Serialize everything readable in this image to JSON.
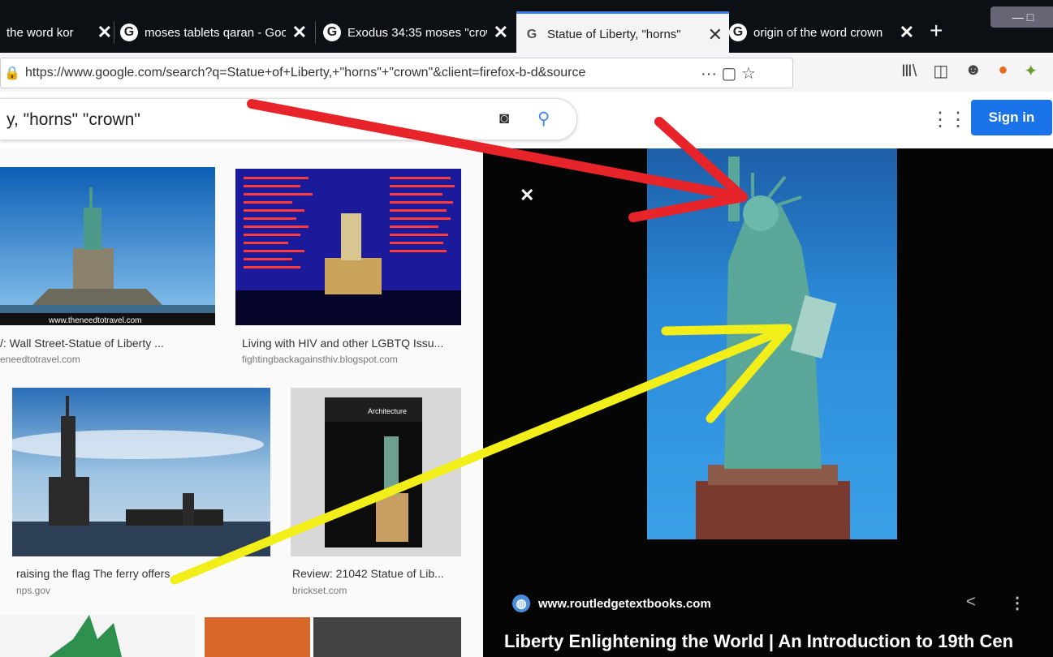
{
  "tabs": [
    {
      "title": "the word kor",
      "close": "✕"
    },
    {
      "title": "moses tablets qaran - Goo",
      "close": "✕"
    },
    {
      "title": "Exodus 34:35 moses \"crow",
      "close": "✕"
    },
    {
      "title": "Statue of Liberty, \"horns\"",
      "close": "✕"
    },
    {
      "title": "origin of the word crown",
      "close": "✕"
    }
  ],
  "browser": {
    "url": "https://www.google.com/search?q=Statue+of+Liberty,+\"horns\"+\"crown\"&client=firefox-b-d&source",
    "new_tab": "+",
    "page_actions": "··· ▢ ☆",
    "window_buttons": "— □"
  },
  "google": {
    "query": "y, \"horns\" \"crown\"",
    "signin": "Sign in"
  },
  "results": [
    {
      "caption": "/: Wall Street-Statue of Liberty ...",
      "site": "eneedtotravel.com",
      "watermark": "www.theneedtotravel.com"
    },
    {
      "caption": "Living with HIV and other LGBTQ Issu...",
      "site": "fightingbackagainsthiv.blogspot.com"
    },
    {
      "caption": "raising the flag The ferry offers",
      "site": "nps.gov"
    },
    {
      "caption": "Review: 21042 Statue of Lib...",
      "site": "brickset.com",
      "box_label": "Architecture"
    }
  ],
  "preview": {
    "source": "www.routledgetextbooks.com",
    "title": "Liberty Enlightening the World | An Introduction to 19th Cen"
  },
  "colors": {
    "red_arrow": "#e8242b",
    "yellow_arrow": "#f2ee1a",
    "signin_blue": "#1a73e8"
  }
}
